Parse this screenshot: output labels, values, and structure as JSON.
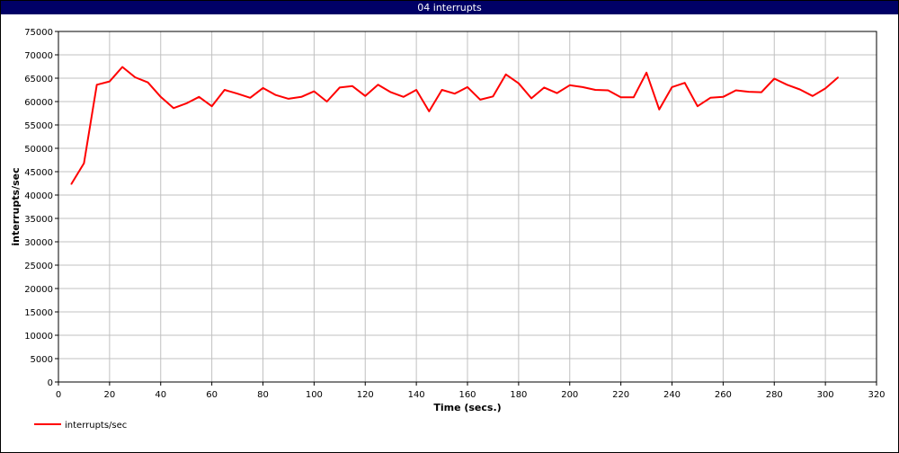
{
  "window": {
    "title": "04 interrupts"
  },
  "chart_data": {
    "type": "line",
    "title": "04 interrupts",
    "xlabel": "Time (secs.)",
    "ylabel": "interrupts/sec",
    "xlim": [
      0,
      320
    ],
    "ylim": [
      0,
      75000
    ],
    "xticks": [
      0,
      20,
      40,
      60,
      80,
      100,
      120,
      140,
      160,
      180,
      200,
      220,
      240,
      260,
      280,
      300,
      320
    ],
    "yticks": [
      0,
      5000,
      10000,
      15000,
      20000,
      25000,
      30000,
      35000,
      40000,
      45000,
      50000,
      55000,
      60000,
      65000,
      70000,
      75000
    ],
    "grid": true,
    "legend_position": "bottom-left",
    "series": [
      {
        "name": "interrupts/sec",
        "color": "#ff0000",
        "x": [
          5,
          10,
          15,
          20,
          25,
          30,
          35,
          40,
          45,
          50,
          55,
          60,
          65,
          70,
          75,
          80,
          85,
          90,
          95,
          100,
          105,
          110,
          115,
          120,
          125,
          130,
          135,
          140,
          145,
          150,
          155,
          160,
          165,
          170,
          175,
          180,
          185,
          190,
          195,
          200,
          205,
          210,
          215,
          220,
          225,
          230,
          235,
          240,
          245,
          250,
          255,
          260,
          265,
          270,
          275,
          280,
          285,
          290,
          295,
          300,
          305
        ],
        "y": [
          42300,
          46800,
          63600,
          64300,
          67400,
          65200,
          64100,
          61000,
          58600,
          59600,
          61000,
          59000,
          62500,
          61700,
          60800,
          62900,
          61400,
          60600,
          61000,
          62200,
          60000,
          63000,
          63300,
          61200,
          63600,
          62000,
          61000,
          62500,
          57900,
          62500,
          61700,
          63100,
          60400,
          61100,
          65800,
          63900,
          60700,
          63000,
          61800,
          63500,
          63100,
          62500,
          62400,
          60900,
          60900,
          66200,
          58300,
          63100,
          64000,
          59000,
          60800,
          61000,
          62400,
          62100,
          62000,
          64900,
          63600,
          62600,
          61200,
          62800,
          65200
        ]
      }
    ]
  }
}
